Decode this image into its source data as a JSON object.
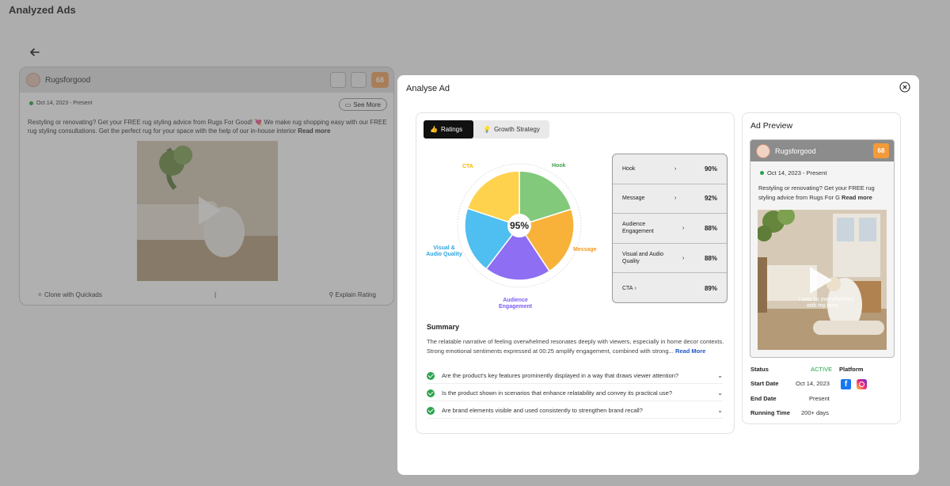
{
  "page": {
    "title": "Analyzed Ads"
  },
  "bg_card": {
    "brand": "Rugsforgood",
    "score": "68",
    "date": "Oct 14, 2023 - Present",
    "see_more": "See More",
    "description": "Restyling or renovating? Get your FREE rug styling advice from Rugs For Good! 💘 We make rug shopping easy with our FREE rug styling consultations. Get the perfect rug for your space with the help of our in-house interior",
    "read_more": "Read more",
    "clone_label": "Clone with Quickads",
    "explain_label": "Explain Rating"
  },
  "modal": {
    "title": "Analyse Ad",
    "tabs": [
      {
        "label": "Ratings"
      },
      {
        "label": "Growth Strategy"
      }
    ],
    "overall_score": "95%",
    "chart_data": {
      "type": "pie",
      "title": "",
      "categories": [
        "Hook",
        "Message",
        "Audience Engagement",
        "Visual & Audio Quality",
        "CTA"
      ],
      "values": [
        90,
        92,
        88,
        88,
        89
      ],
      "colors": [
        "#82c97c",
        "#f8b23a",
        "#8e6ef2",
        "#4fbef0",
        "#ffd24d"
      ],
      "label_colors": [
        "#3ea34a",
        "#f39a1e",
        "#7b5cf0",
        "#2ba5e2",
        "#f2b600"
      ],
      "center_label": "95%"
    },
    "chart_labels": {
      "hook": "Hook",
      "message": "Message",
      "audience_1": "Audience",
      "audience_2": "Engagement",
      "visual_1": "Visual &",
      "visual_2": "Audio Quality",
      "cta": "CTA"
    },
    "ratings": [
      {
        "name": "Hook",
        "value": "90%"
      },
      {
        "name": "Message",
        "value": "92%"
      },
      {
        "name": "Audience Engagement",
        "value": "88%"
      },
      {
        "name": "Visual and Audio Quality",
        "value": "88%"
      },
      {
        "name": "CTA",
        "value": "89%"
      }
    ],
    "summary": {
      "title": "Summary",
      "text": "The relatable narrative of feeling overwhelmed resonates deeply with viewers, especially in home decor contexts. Strong emotional sentiments expressed at 00:25 amplify engagement, combined with strong...",
      "read_more": "Read More"
    },
    "questions": [
      "Are the product's key features prominently displayed in a way that draws viewer attention?",
      "Is the product shown in scenarios that enhance relatability and convey its practical use?",
      "Are brand elements visible and used consistently to strengthen brand recall?"
    ],
    "preview": {
      "title": "Ad Preview",
      "brand": "Rugsforgood",
      "score": "68",
      "date": "Oct 14, 2023 - Present",
      "description": "Restyling or renovating? Get your FREE rug styling advice from Rugs For G",
      "read_more": "Read more",
      "video_caption_1": "I was so overwhelmed",
      "video_caption_2": "with my reno."
    },
    "meta": {
      "status_label": "Status",
      "status_value": "ACTIVE",
      "platform_label": "Platform",
      "start_label": "Start Date",
      "start_value": "Oct 14, 2023",
      "end_label": "End Date",
      "end_value": "Present",
      "running_label": "Running Time",
      "running_value": "200+ days"
    }
  }
}
